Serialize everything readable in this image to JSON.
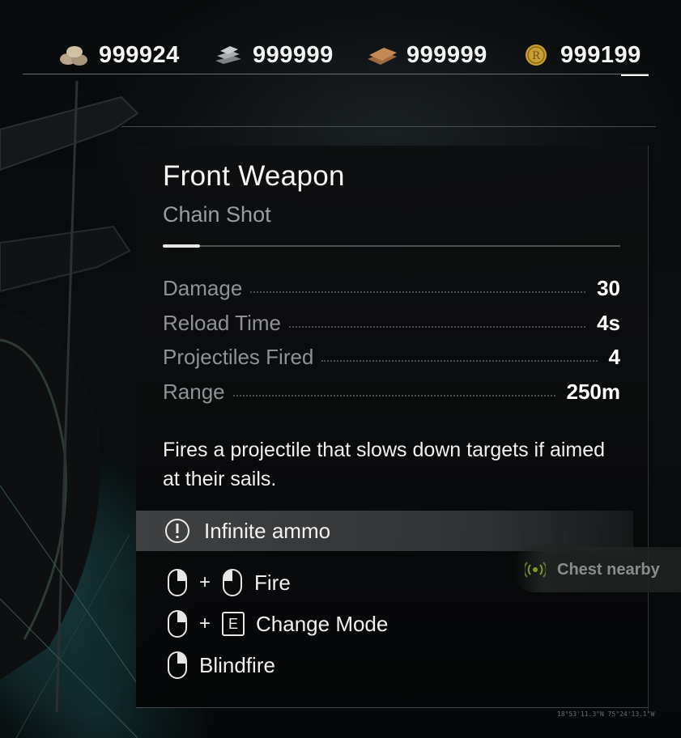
{
  "resources": [
    {
      "icon": "stone-resource-icon",
      "value": "999924"
    },
    {
      "icon": "iron-ingot-resource-icon",
      "value": "999999"
    },
    {
      "icon": "wood-plank-resource-icon",
      "value": "999999"
    },
    {
      "icon": "gold-coin-resource-icon",
      "value": "999199"
    }
  ],
  "weapon": {
    "title": "Front Weapon",
    "subtitle": "Chain Shot",
    "stats": [
      {
        "label": "Damage",
        "value": "30"
      },
      {
        "label": "Reload Time",
        "value": "4s"
      },
      {
        "label": "Projectiles Fired",
        "value": "4"
      },
      {
        "label": "Range",
        "value": "250m"
      }
    ],
    "description": "Fires a projectile that slows down targets if aimed at their sails.",
    "ammo": "Infinite ammo"
  },
  "controls": [
    {
      "inputs": [
        "mouse-right-button-icon",
        "mouse-left-button-icon"
      ],
      "action": "Fire"
    },
    {
      "inputs": [
        "mouse-right-button-icon",
        "E"
      ],
      "action": "Change Mode"
    },
    {
      "inputs": [
        "mouse-right-button-icon"
      ],
      "action": "Blindfire"
    }
  ],
  "notification": {
    "text": "Chest nearby",
    "icon": "signal-icon"
  },
  "coords": "18°53'11.3\"N 75°24'13.1\"W",
  "colors": {
    "accent_text": "#ffffff",
    "muted_text": "#8f9294",
    "chest_icon": "#7c9a2e",
    "coin_gold": "#c9a030"
  }
}
